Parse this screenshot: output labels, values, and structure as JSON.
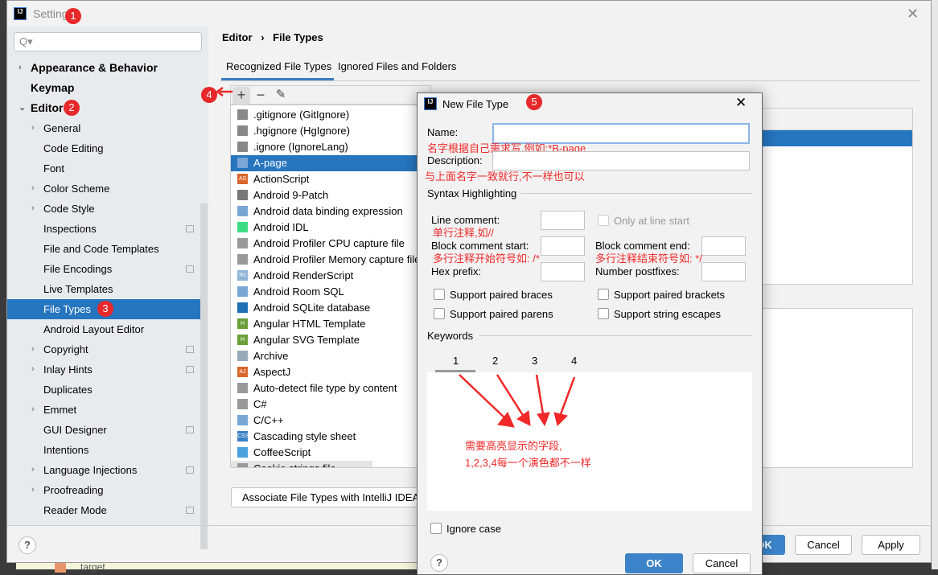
{
  "window": {
    "title": "Settings",
    "close": "✕"
  },
  "sidebar": {
    "search_placeholder": "Q▾",
    "items": [
      {
        "label": "Appearance & Behavior",
        "level": 0,
        "chev": "›",
        "bold": true
      },
      {
        "label": "Keymap",
        "level": 0,
        "bold": true
      },
      {
        "label": "Editor",
        "level": 0,
        "chev": "⌄",
        "bold": true
      },
      {
        "label": "General",
        "level": 1,
        "chev": "›"
      },
      {
        "label": "Code Editing",
        "level": 1
      },
      {
        "label": "Font",
        "level": 1
      },
      {
        "label": "Color Scheme",
        "level": 1,
        "chev": "›"
      },
      {
        "label": "Code Style",
        "level": 1,
        "chev": "›"
      },
      {
        "label": "Inspections",
        "level": 1,
        "cfg": true
      },
      {
        "label": "File and Code Templates",
        "level": 1
      },
      {
        "label": "File Encodings",
        "level": 1,
        "cfg": true
      },
      {
        "label": "Live Templates",
        "level": 1
      },
      {
        "label": "File Types",
        "level": 1,
        "selected": true
      },
      {
        "label": "Android Layout Editor",
        "level": 1
      },
      {
        "label": "Copyright",
        "level": 1,
        "chev": "›",
        "cfg": true
      },
      {
        "label": "Inlay Hints",
        "level": 1,
        "chev": "›",
        "cfg": true
      },
      {
        "label": "Duplicates",
        "level": 1
      },
      {
        "label": "Emmet",
        "level": 1,
        "chev": "›"
      },
      {
        "label": "GUI Designer",
        "level": 1,
        "cfg": true
      },
      {
        "label": "Intentions",
        "level": 1
      },
      {
        "label": "Language Injections",
        "level": 1,
        "chev": "›",
        "cfg": true
      },
      {
        "label": "Proofreading",
        "level": 1,
        "chev": "›"
      },
      {
        "label": "Reader Mode",
        "level": 1,
        "cfg": true
      }
    ]
  },
  "breadcrumb": {
    "parent": "Editor",
    "sep": "›",
    "current": "File Types"
  },
  "tabs": [
    {
      "label": "Recognized File Types",
      "active": true
    },
    {
      "label": "Ignored Files and Folders"
    }
  ],
  "toolbar": {
    "add": "+",
    "remove": "−",
    "edit": "✎"
  },
  "file_types": [
    {
      "label": ".gitignore (GitIgnore)",
      "icon": "ignore-icon",
      "color": "#888"
    },
    {
      "label": ".hgignore (HgIgnore)",
      "icon": "ignore-icon",
      "color": "#888"
    },
    {
      "label": ".ignore (IgnoreLang)",
      "icon": "ignore-icon",
      "color": "#888"
    },
    {
      "label": "A-page",
      "icon": "custom-file-icon",
      "color": "#7aa6d6",
      "selected": true
    },
    {
      "label": "ActionScript",
      "icon": "actionscript-icon",
      "color": "#d9662b",
      "text": "AS"
    },
    {
      "label": "Android 9-Patch",
      "icon": "folder-icon",
      "color": "#777"
    },
    {
      "label": "Android data binding expression",
      "icon": "custom-file-icon",
      "color": "#7aa6d6"
    },
    {
      "label": "Android IDL",
      "icon": "android-icon",
      "color": "#3ddc84"
    },
    {
      "label": "Android Profiler CPU capture file",
      "icon": "profiler-icon",
      "color": "#999"
    },
    {
      "label": "Android Profiler Memory capture file",
      "icon": "profiler-icon",
      "color": "#999"
    },
    {
      "label": "Android RenderScript",
      "icon": "renderscript-icon",
      "color": "#8fb4d8",
      "text": "Rs"
    },
    {
      "label": "Android Room SQL",
      "icon": "custom-file-icon",
      "color": "#7aa6d6"
    },
    {
      "label": "Android SQLite database",
      "icon": "sqlite-icon",
      "color": "#1f6fb5"
    },
    {
      "label": "Angular HTML Template",
      "icon": "html-icon",
      "color": "#6a9f3a",
      "text": "H"
    },
    {
      "label": "Angular SVG Template",
      "icon": "html-icon",
      "color": "#6a9f3a",
      "text": "H"
    },
    {
      "label": "Archive",
      "icon": "archive-icon",
      "color": "#9aa9b8"
    },
    {
      "label": "AspectJ",
      "icon": "aspectj-icon",
      "color": "#d9662b",
      "text": "AJ"
    },
    {
      "label": "Auto-detect file type by content",
      "icon": "file-icon",
      "color": "#999"
    },
    {
      "label": "C#",
      "icon": "file-icon",
      "color": "#999"
    },
    {
      "label": "C/C++",
      "icon": "custom-file-icon",
      "color": "#7aa6d6"
    },
    {
      "label": "Cascading style sheet",
      "icon": "css-icon",
      "color": "#3a7fc4",
      "text": "CSS"
    },
    {
      "label": "CoffeeScript",
      "icon": "coffee-icon",
      "color": "#4aa3df"
    },
    {
      "label": "Cookie strings file",
      "icon": "file-icon",
      "color": "#999"
    }
  ],
  "associate_button": "Associate File Types with IntelliJ IDEA...",
  "footer": {
    "help": "?",
    "ok": "OK",
    "cancel": "Cancel",
    "apply": "Apply"
  },
  "dialog": {
    "title": "New File Type",
    "close": "✕",
    "name_label": "Name:",
    "name_value": "",
    "description_label": "Description:",
    "description_value": "",
    "syntax_section": "Syntax Highlighting",
    "line_comment": "Line comment:",
    "only_line_start": "Only at line start",
    "block_start": "Block comment start:",
    "block_end": "Block comment end:",
    "hex_prefix": "Hex prefix:",
    "number_postfixes": "Number postfixes:",
    "paired_braces": "Support paired braces",
    "paired_brackets": "Support paired brackets",
    "paired_parens": "Support paired parens",
    "string_escapes": "Support string escapes",
    "keywords_section": "Keywords",
    "keyword_tabs": [
      "1",
      "2",
      "3",
      "4"
    ],
    "ignore_case": "Ignore case",
    "help": "?",
    "ok": "OK",
    "cancel": "Cancel"
  },
  "annotations": {
    "badges": [
      "1",
      "2",
      "3",
      "4",
      "5"
    ],
    "name_note": "名字根据自己需求写,例如:*B-page",
    "description_note": "与上面名字一致就行,不一样也可以",
    "line_note": "单行注释,如//",
    "block_start_note": "多行注释开始符号如: /*",
    "block_end_note": "多行注释结束符号如: */",
    "keywords_note1": "需要高亮显示的字段,",
    "keywords_note2": "1,2,3,4每一个演色都不一样",
    "color": "#f02828"
  },
  "background": {
    "tree_item": "target"
  },
  "colors": {
    "selection": "#2675bf",
    "sidebar": "#e8ebee",
    "panel": "#f2f2f2"
  }
}
